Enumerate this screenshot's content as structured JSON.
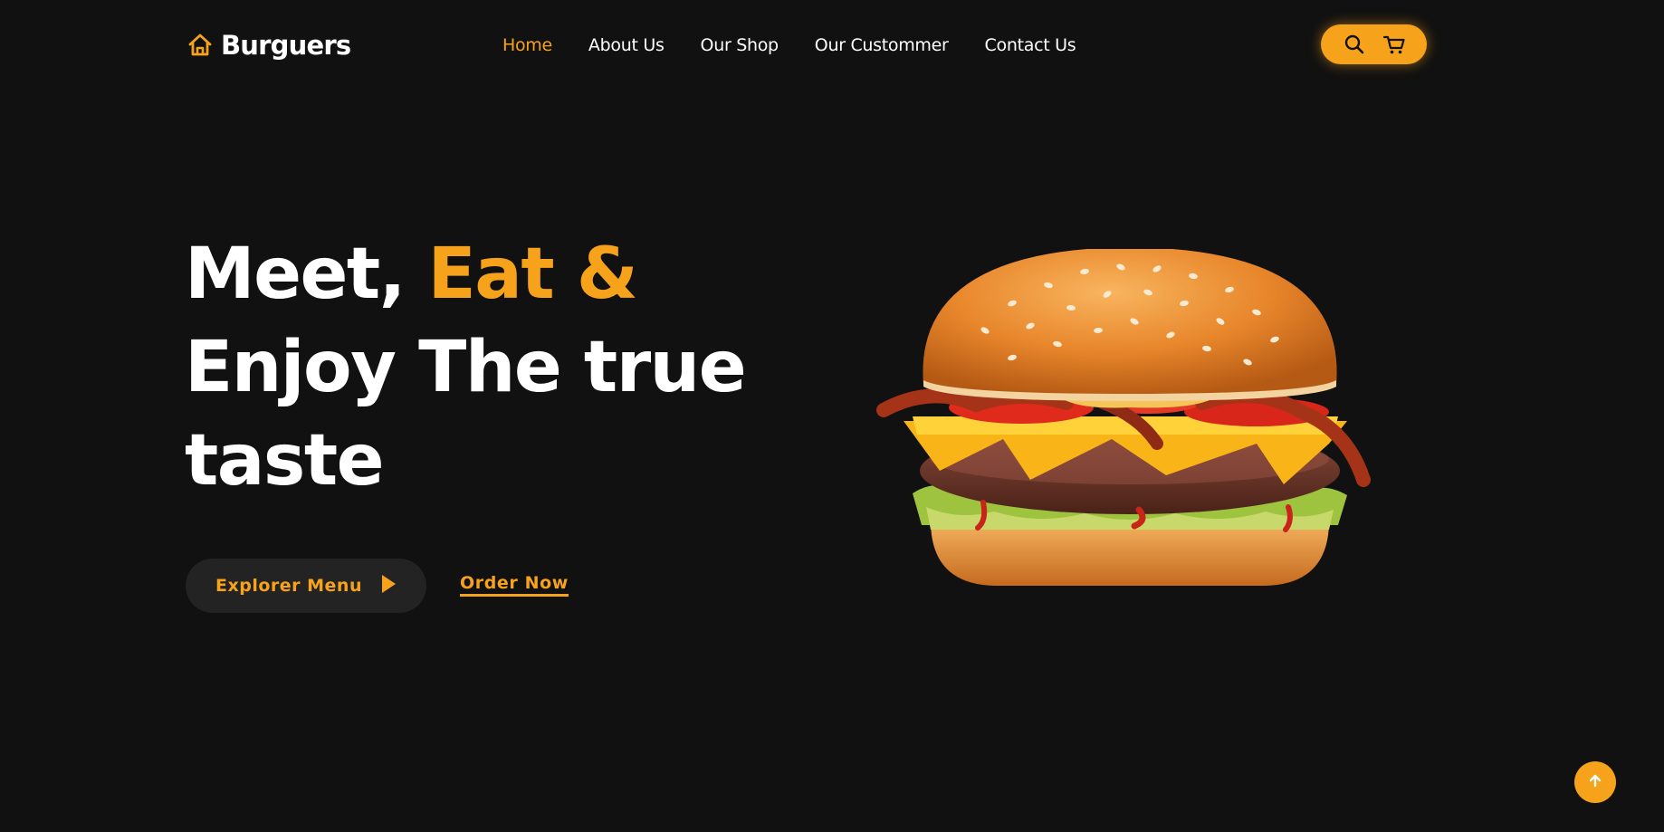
{
  "brand": {
    "name": "Burguers",
    "icon": "home-icon"
  },
  "nav": {
    "items": [
      {
        "label": "Home",
        "active": true
      },
      {
        "label": "About Us",
        "active": false
      },
      {
        "label": "Our Shop",
        "active": false
      },
      {
        "label": "Our Custommer",
        "active": false
      },
      {
        "label": "Contact Us",
        "active": false
      }
    ]
  },
  "header_actions": {
    "search_icon": "search-icon",
    "cart_icon": "cart-icon"
  },
  "hero": {
    "title_line1_white": "Meet, ",
    "title_line1_accent": "Eat &",
    "title_line2": "Enjoy The true",
    "title_line3": "taste",
    "primary_button": "Explorer Menu",
    "primary_button_icon": "play-icon",
    "secondary_link": "Order Now",
    "image": "burger-image"
  },
  "scroll_top": {
    "icon": "arrow-up-icon"
  },
  "colors": {
    "background": "#111111",
    "accent": "#f7a21b",
    "button_bg": "#232323",
    "text": "#ffffff"
  }
}
